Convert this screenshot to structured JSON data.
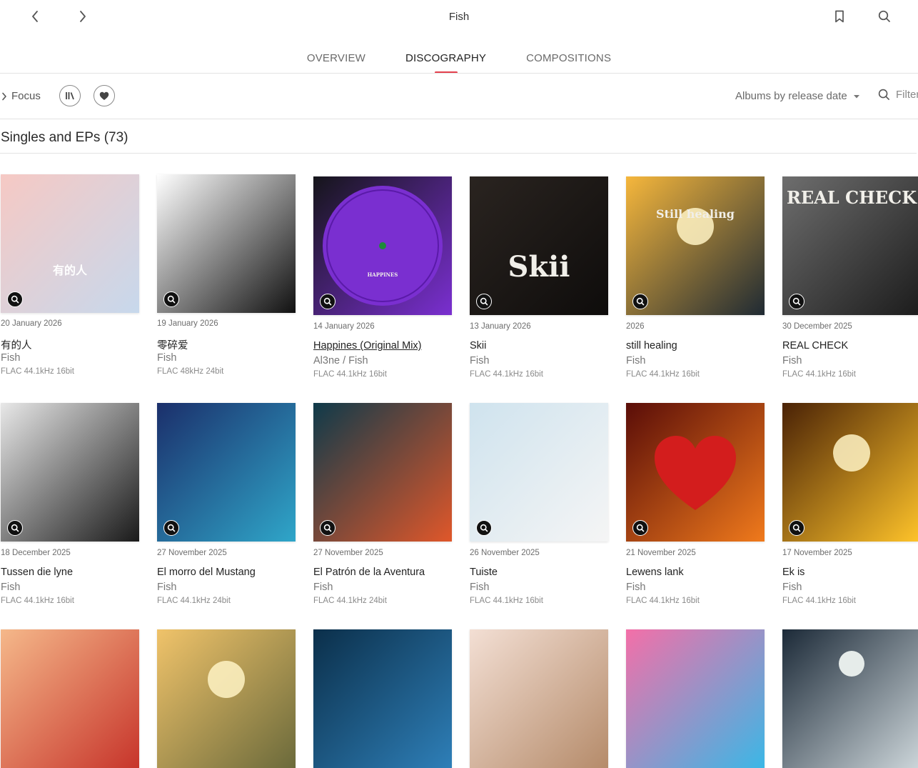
{
  "header": {
    "title": "Fish",
    "back_icon": "chevron-left-icon",
    "forward_icon": "chevron-right-icon",
    "bookmark_icon": "bookmark-icon",
    "search_icon": "search-icon"
  },
  "tabs": [
    {
      "label": "OVERVIEW",
      "active": false
    },
    {
      "label": "DISCOGRAPHY",
      "active": true
    },
    {
      "label": "COMPOSITIONS",
      "active": false
    }
  ],
  "toolbar": {
    "focus_label": "Focus",
    "sort_label": "Albums by release date",
    "filter_placeholder": "Filter"
  },
  "section": {
    "title": "Singles and EPs (73)"
  },
  "accent_color": "#e4414e",
  "releases": [
    {
      "date": "20 January 2026",
      "title": "有的人",
      "artist": "Fish",
      "quality": "FLAC 44.1kHz 16bit",
      "colors": [
        "#f6c9c4",
        "#c7d8ec"
      ],
      "art": "有的人"
    },
    {
      "date": "19 January 2026",
      "title": "零碎爱",
      "artist": "Fish",
      "quality": "FLAC 48kHz 24bit",
      "colors": [
        "#ffffff",
        "#111111"
      ],
      "art": ""
    },
    {
      "date": "14 January 2026",
      "title": "Happines (Original Mix)",
      "artist": "Al3ne / Fish",
      "quality": "FLAC 44.1kHz 16bit",
      "colors": [
        "#15151a",
        "#7a2fd0"
      ],
      "art": "HAPPINES"
    },
    {
      "date": "13 January 2026",
      "title": "Skii",
      "artist": "Fish",
      "quality": "FLAC 44.1kHz 16bit",
      "colors": [
        "#2a2420",
        "#0e0c0b"
      ],
      "art": "Skii"
    },
    {
      "date": "2026",
      "title": "still healing",
      "artist": "Fish",
      "quality": "FLAC 44.1kHz 16bit",
      "colors": [
        "#f6b73c",
        "#1f2a33"
      ],
      "art": "Still healing"
    },
    {
      "date": "30 December 2025",
      "title": "REAL CHECK",
      "artist": "Fish",
      "quality": "FLAC 44.1kHz 16bit",
      "colors": [
        "#6e6e6e",
        "#1c1c1c"
      ],
      "art": "REAL CHECK"
    },
    {
      "date": "18 December 2025",
      "title": "Tussen die lyne",
      "artist": "Fish",
      "quality": "FLAC 44.1kHz 16bit",
      "colors": [
        "#e8e8e8",
        "#1a1a1a"
      ],
      "art": ""
    },
    {
      "date": "27 November 2025",
      "title": "El morro del Mustang",
      "artist": "Fish",
      "quality": "FLAC 44.1kHz 24bit",
      "colors": [
        "#1b2f6b",
        "#2fa6c9"
      ],
      "art": ""
    },
    {
      "date": "27 November 2025",
      "title": "El Patrón de la Aventura",
      "artist": "Fish",
      "quality": "FLAC 44.1kHz 24bit",
      "colors": [
        "#0f3a4a",
        "#e0572a"
      ],
      "art": ""
    },
    {
      "date": "26 November 2025",
      "title": "Tuiste",
      "artist": "Fish",
      "quality": "FLAC 44.1kHz 16bit",
      "colors": [
        "#cfe3ee",
        "#f5f5f5"
      ],
      "art": ""
    },
    {
      "date": "21 November 2025",
      "title": "Lewens lank",
      "artist": "Fish",
      "quality": "FLAC 44.1kHz 16bit",
      "colors": [
        "#5a0d08",
        "#f07a1c"
      ],
      "art": ""
    },
    {
      "date": "17 November 2025",
      "title": "Ek is",
      "artist": "Fish",
      "quality": "FLAC 44.1kHz 16bit",
      "colors": [
        "#4a2206",
        "#ffc42a"
      ],
      "art": ""
    },
    {
      "date": "",
      "title": "",
      "artist": "",
      "quality": "",
      "colors": [
        "#f5b88a",
        "#c7352b"
      ],
      "art": ""
    },
    {
      "date": "",
      "title": "",
      "artist": "",
      "quality": "",
      "colors": [
        "#f0c36a",
        "#6b6a3b"
      ],
      "art": ""
    },
    {
      "date": "",
      "title": "",
      "artist": "",
      "quality": "",
      "colors": [
        "#0b2f4a",
        "#2e7fb8"
      ],
      "art": ""
    },
    {
      "date": "",
      "title": "",
      "artist": "",
      "quality": "",
      "colors": [
        "#f3dfd4",
        "#b58b6a"
      ],
      "art": ""
    },
    {
      "date": "",
      "title": "",
      "artist": "",
      "quality": "",
      "colors": [
        "#f46fa8",
        "#3bb7e6"
      ],
      "art": ""
    },
    {
      "date": "",
      "title": "",
      "artist": "",
      "quality": "",
      "colors": [
        "#1c2a38",
        "#cdd6da"
      ],
      "art": ""
    }
  ]
}
